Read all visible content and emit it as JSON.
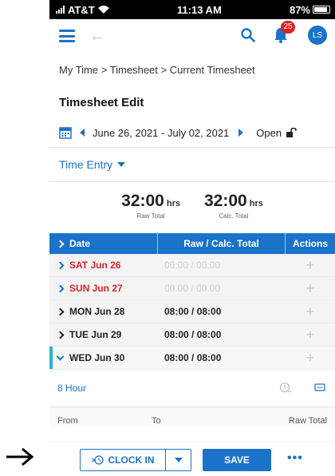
{
  "status_bar": {
    "carrier": "AT&T",
    "time": "11:13 AM",
    "battery": "87%"
  },
  "app_bar": {
    "notification_count": "25",
    "avatar_initials": "LS"
  },
  "breadcrumb": "My Time > Timesheet > Current Timesheet",
  "page_title": "Timesheet Edit",
  "period": {
    "range": "June 26, 2021 - July 02, 2021",
    "status": "Open"
  },
  "entry_tab": {
    "label": "Time Entry"
  },
  "totals": {
    "raw": {
      "value": "32:00",
      "unit": "hrs",
      "caption": "Raw Total"
    },
    "calc": {
      "value": "32:00",
      "unit": "hrs",
      "caption": "Calc. Total"
    }
  },
  "grid": {
    "headers": {
      "date": "Date",
      "total": "Raw / Calc. Total",
      "actions": "Actions"
    },
    "rows": [
      {
        "day": "SAT Jun 26",
        "total": "00:00 / 00:00",
        "action": "+"
      },
      {
        "day": "SUN Jun 27",
        "total": "00:00 / 00:00",
        "action": "+"
      },
      {
        "day": "MON Jun 28",
        "total": "08:00 / 08:00",
        "action": "+"
      },
      {
        "day": "TUE Jun 29",
        "total": "08:00 / 08:00",
        "action": "+"
      },
      {
        "day": "WED Jun 30",
        "total": "08:00 / 08:00",
        "action": "+"
      }
    ]
  },
  "detail": {
    "label": "8 Hour"
  },
  "subheader": {
    "from": "From",
    "to": "To",
    "raw_total": "Raw Total"
  },
  "actions": {
    "clock_in": "CLOCK IN",
    "save": "SAVE",
    "more": "•••"
  },
  "colors": {
    "primary": "#1a73c8",
    "weekend": "#d8232a",
    "badge": "#e0201f",
    "expanded_marker": "#2bb3d6"
  }
}
